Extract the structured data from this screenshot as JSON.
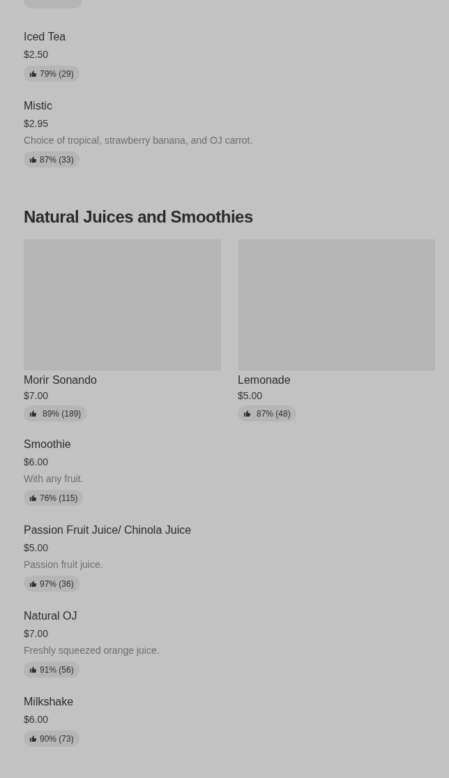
{
  "items_before": [
    {
      "name": "Iced Tea",
      "price": "$2.50",
      "rating": "79% (29)"
    },
    {
      "name": "Mistic",
      "price": "$2.95",
      "description": "Choice of tropical, strawberry banana, and OJ carrot.",
      "rating": "87% (33)"
    }
  ],
  "section": {
    "title": "Natural Juices and Smoothies",
    "featured": [
      {
        "name": "Morir Sonando",
        "price": "$7.00",
        "rating": "89% (189)"
      },
      {
        "name": "Lemonade",
        "price": "$5.00",
        "rating": "87% (48)"
      }
    ],
    "items": [
      {
        "name": "Smoothie",
        "price": "$6.00",
        "description": "With any fruit.",
        "rating": "76% (115)"
      },
      {
        "name": "Passion Fruit Juice/ Chinola Juice",
        "price": "$5.00",
        "description": "Passion fruit juice.",
        "rating": "97% (36)"
      },
      {
        "name": "Natural OJ",
        "price": "$7.00",
        "description": "Freshly squeezed orange juice.",
        "rating": "91% (56)"
      },
      {
        "name": "Milkshake",
        "price": "$6.00",
        "rating": "90% (73)"
      }
    ]
  }
}
